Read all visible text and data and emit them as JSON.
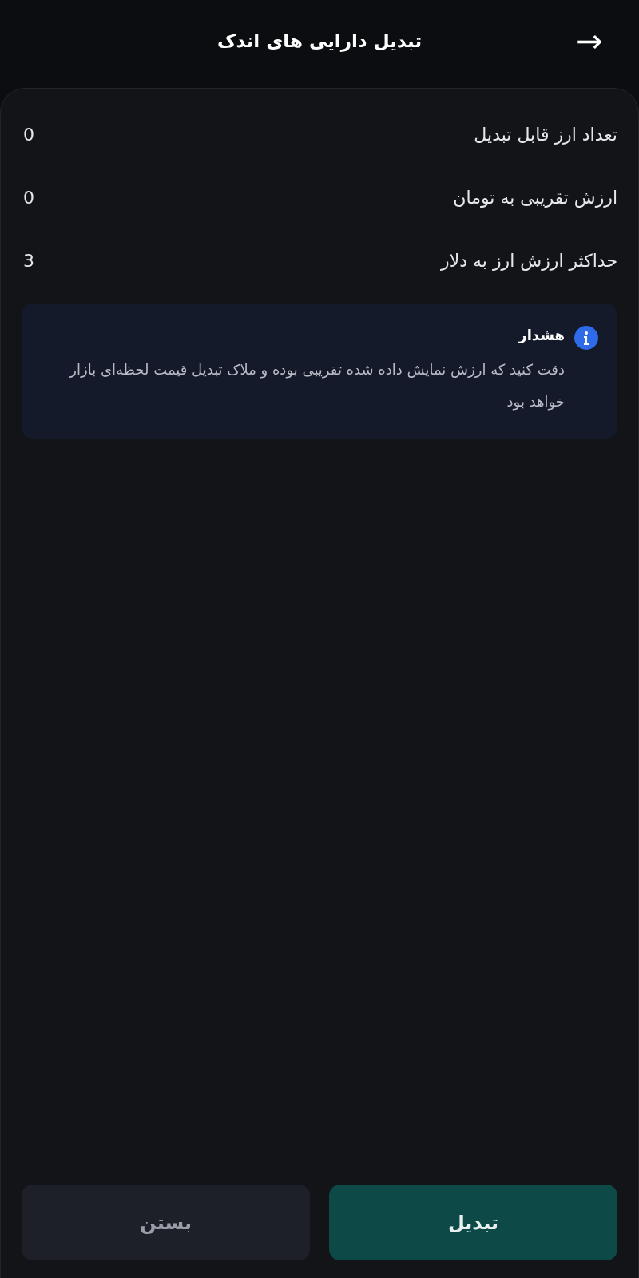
{
  "header": {
    "title": "تبدیل دارایی های اندک",
    "back_arrow": "→"
  },
  "rows": [
    {
      "label": "تعداد ارز قابل تبدیل",
      "value": "0"
    },
    {
      "label": "ارزش تقریبی به تومان",
      "value": "0"
    },
    {
      "label": "حداکثر ارزش ارز به دلار",
      "value": "3"
    }
  ],
  "warning": {
    "title": "هشدار",
    "text": "دقت کنید که ارزش نمایش داده شده تقریبی بوده و ملاک تبدیل قیمت لحظه‌ای بازار خواهد بود"
  },
  "buttons": [
    {
      "kind": "primary",
      "label": "تبدیل"
    },
    {
      "kind": "secondary",
      "label": "بستن"
    }
  ]
}
